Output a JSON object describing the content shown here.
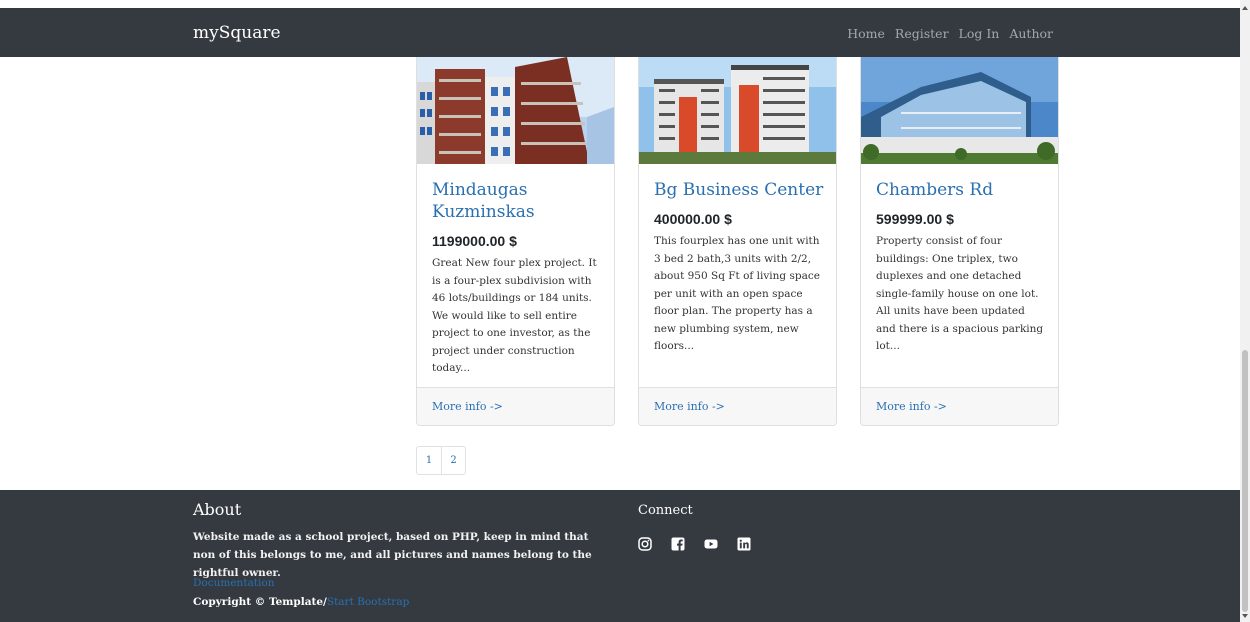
{
  "nav": {
    "brand": "mySquare",
    "links": [
      "Home",
      "Register",
      "Log In",
      "Author"
    ]
  },
  "listings": [
    {
      "title": "Mindaugas Kuzminskas",
      "price": "1199000.00 $",
      "description": "Great New four plex project. It is a four-plex subdivision with 46 lots/buildings or 184 units. We would like to sell entire project to one investor, as the project under construction today...",
      "link": "More info ->"
    },
    {
      "title": "Bg Business Center",
      "price": "400000.00 $",
      "description": "This fourplex has one unit with 3 bed 2 bath,3 units with 2/2, about 950 Sq Ft of living space per unit with an open space floor plan. The property has a new plumbing system, new floors...",
      "link": "More info ->"
    },
    {
      "title": "Chambers Rd",
      "price": "599999.00 $",
      "description": "Property consist of four buildings: One triplex, two duplexes and one detached single-family house on one lot. All units have been updated and there is a spacious parking lot...",
      "link": "More info ->"
    }
  ],
  "pagination": {
    "pages": [
      "1",
      "2"
    ]
  },
  "footer": {
    "about_title": "About",
    "about_text": "Website made as a school project, based on PHP, keep in mind that non of this belongs to me, and all pictures and names belong to the rightful owner.",
    "documentation": "Documentation",
    "copyright_prefix": "Copyright © Template/",
    "copyright_link": "Start Bootstrap",
    "connect_title": "Connect",
    "social_icons": [
      "instagram-icon",
      "facebook-icon",
      "youtube-icon",
      "linkedin-icon"
    ]
  },
  "colors": {
    "navbar_bg": "#343a40",
    "link": "#2a6fb0",
    "footer_bg": "#343a40"
  }
}
